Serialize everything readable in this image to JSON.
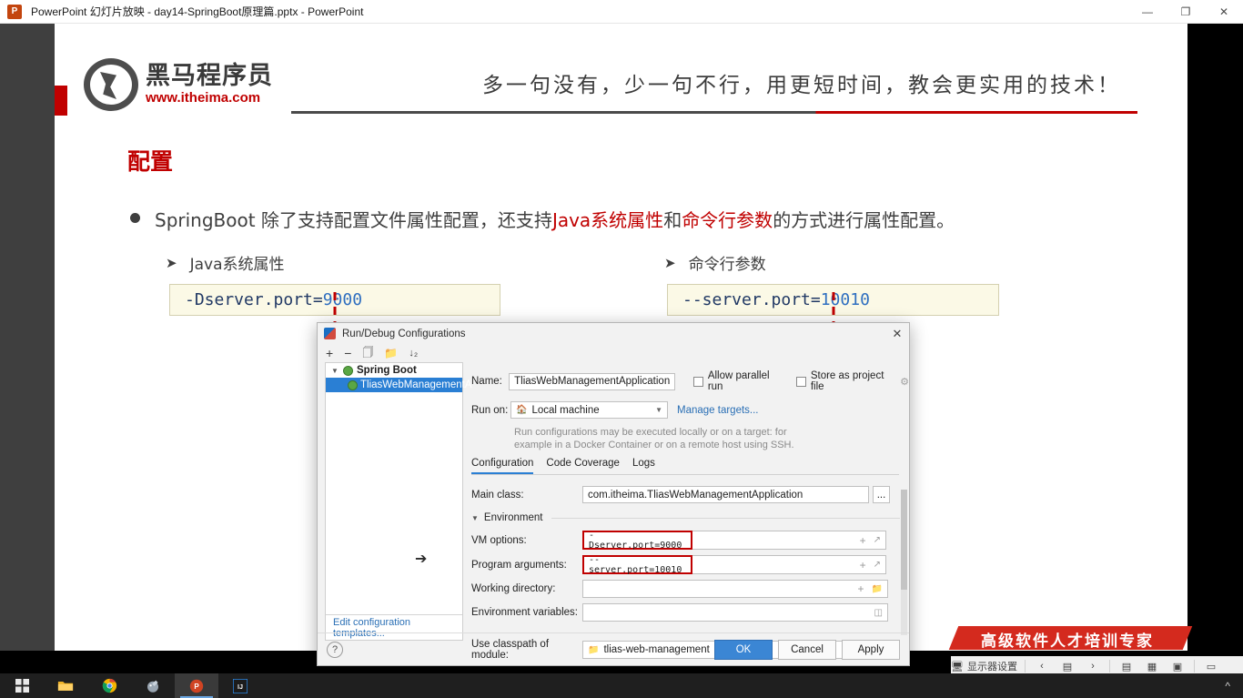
{
  "titlebar": {
    "app_icon": "powerpoint-icon",
    "title": "PowerPoint 幻灯片放映  -  day14-SpringBoot原理篇.pptx - PowerPoint",
    "minimize": "—",
    "restore": "❐",
    "close": "✕"
  },
  "slide": {
    "logo": {
      "name_cn": "黑马程序员",
      "url": "www.itheima.com"
    },
    "slogan": "多一句没有，少一句不行，用更短时间，教会更实用的技术！",
    "title": "配置",
    "bullet": {
      "part1": "SpringBoot 除了支持配置文件属性配置，还支持",
      "em1": "Java系统属性",
      "part2": "和",
      "em2": "命令行参数",
      "part3": "的方式进行属性配置。"
    },
    "sub_items": [
      {
        "label": "Java系统属性",
        "code_key": "-Dserver.port=",
        "code_val": "9000"
      },
      {
        "label": "命令行参数",
        "code_key": "--server.port=",
        "code_val": "10010"
      }
    ],
    "banner": "高级软件人才培训专家"
  },
  "dialog": {
    "title": "Run/Debug Configurations",
    "close": "✕",
    "toolbar": [
      "add-icon",
      "remove-icon",
      "copy-icon",
      "folder-icon",
      "sort-icon"
    ],
    "tree": {
      "root": "Spring Boot",
      "child": "TliasWebManagementA",
      "templates_link": "Edit configuration templates..."
    },
    "name_label": "Name:",
    "name_value": "TliasWebManagementApplication",
    "allow_parallel_run": "Allow parallel run",
    "store_as_project_file": "Store as project file",
    "run_on_label": "Run on:",
    "run_on_value": "Local machine",
    "manage_targets": "Manage targets...",
    "hint_line1": "Run configurations may be executed locally or on a target: for",
    "hint_line2": "example in a Docker Container or on a remote host using SSH.",
    "tabs": [
      "Configuration",
      "Code Coverage",
      "Logs"
    ],
    "active_tab": "Configuration",
    "fields": [
      {
        "label": "Main class:",
        "value": "com.itheima.TliasWebManagementApplication",
        "browse": "..."
      },
      {
        "label": "VM options:",
        "value": "-Dserver.port=9000",
        "highlighted": true
      },
      {
        "label": "Program arguments:",
        "value": "--server.port=10010",
        "highlighted": true
      },
      {
        "label": "Working directory:",
        "value": ""
      },
      {
        "label": "Environment variables:",
        "value": ""
      },
      {
        "label": "Use classpath of module:",
        "value": "tlias-web-management"
      }
    ],
    "environment_section": "Environment",
    "buttons": {
      "help": "?",
      "ok": "OK",
      "cancel": "Cancel",
      "apply": "Apply"
    }
  },
  "status_bar": {
    "display_settings": "显示器设置",
    "prev": "‹",
    "slide_indicator": "▤",
    "next": "›",
    "view_normal": "▤",
    "view_sorter": "▦",
    "view_reading": "▣",
    "view_show": "▭"
  },
  "taskbar": {
    "items": [
      "windows-start-icon",
      "file-explorer-icon",
      "chrome-icon",
      "paint-icon",
      "powerpoint-icon",
      "intellij-idea-icon"
    ],
    "active": "powerpoint-icon",
    "tray_expand": "^"
  },
  "colors": {
    "brand_red": "#c00000",
    "accent_blue": "#2a7fd4",
    "annotation_red": "#c00000",
    "code_bg": "#fbf9e6"
  }
}
